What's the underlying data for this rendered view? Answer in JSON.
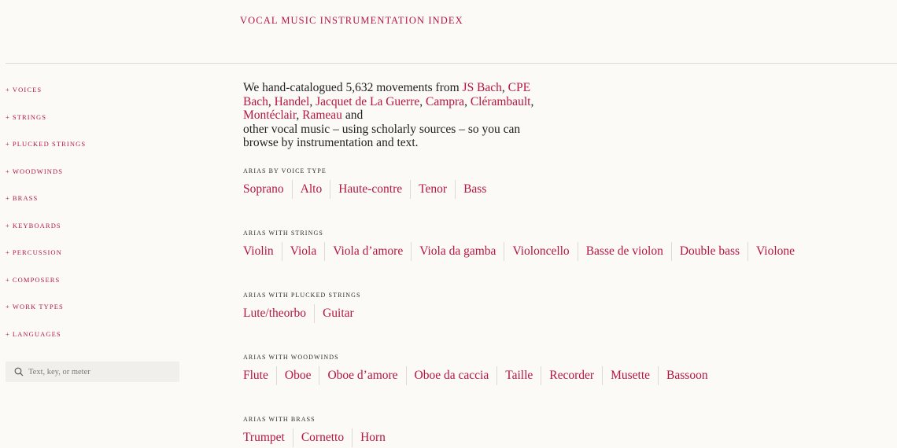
{
  "site": {
    "title": "VOCAL MUSIC INSTRUMENTATION INDEX"
  },
  "sidebar": {
    "items": [
      {
        "label": "Voices"
      },
      {
        "label": "Strings"
      },
      {
        "label": "Plucked strings"
      },
      {
        "label": "Woodwinds"
      },
      {
        "label": "Brass"
      },
      {
        "label": "Keyboards"
      },
      {
        "label": "Percussion"
      },
      {
        "label": "Composers"
      },
      {
        "label": "Work types"
      },
      {
        "label": "Languages"
      }
    ],
    "expand_symbol": "+"
  },
  "search": {
    "placeholder": "Text, key, or meter",
    "icon": "search-icon"
  },
  "intro": {
    "lead": "We hand-catalogued 5,632 movements from ",
    "composers": [
      "JS Bach",
      "CPE Bach",
      "Handel",
      "Jacquet de La Guerre",
      "Campra",
      "Clérambault",
      "Montéclair",
      "Rameau"
    ],
    "and": " and",
    "tail": "other vocal music – using scholarly sources – so you can browse by instrumentation and text."
  },
  "sections": [
    {
      "label": "Arias by voice type",
      "items": [
        "Soprano",
        "Alto",
        "Haute-contre",
        "Tenor",
        "Bass"
      ]
    },
    {
      "label": "Arias with strings",
      "items": [
        "Violin",
        "Viola",
        "Viola d’amore",
        "Viola da gamba",
        "Violoncello",
        "Basse de violon",
        "Double bass",
        "Violone"
      ]
    },
    {
      "label": "Arias with plucked strings",
      "items": [
        "Lute/theorbo",
        "Guitar"
      ]
    },
    {
      "label": "Arias with woodwinds",
      "items": [
        "Flute",
        "Oboe",
        "Oboe d’amore",
        "Oboe da caccia",
        "Taille",
        "Recorder",
        "Musette",
        "Bassoon"
      ]
    },
    {
      "label": "Arias with brass",
      "items": [
        "Trumpet",
        "Cornetto",
        "Horn"
      ]
    }
  ],
  "colors": {
    "accent": "#b5163f",
    "background": "#fbfaf7",
    "text": "#1e1e1e",
    "search_bg": "#f0efeb"
  }
}
